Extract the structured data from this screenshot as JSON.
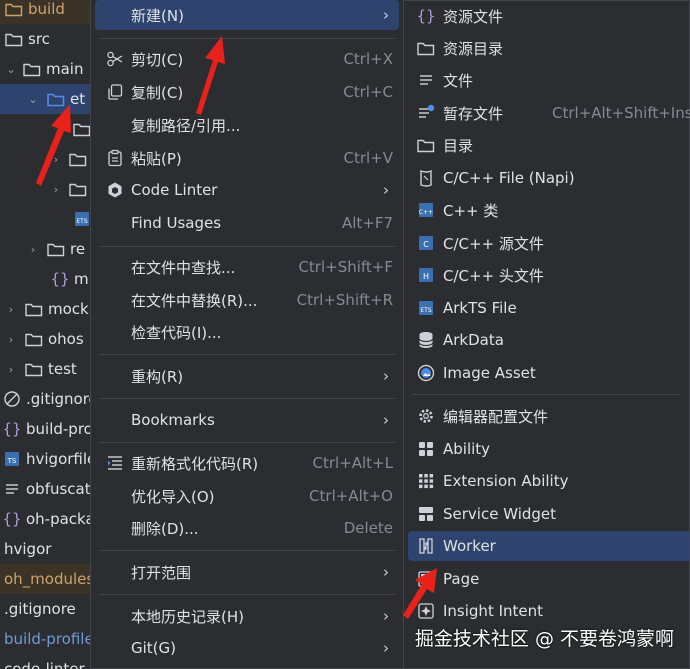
{
  "tree": {
    "items": [
      {
        "label": "build"
      },
      {
        "label": "src"
      },
      {
        "label": "main"
      },
      {
        "label": "et"
      },
      {
        "label": ""
      },
      {
        "label": ""
      },
      {
        "label": ""
      },
      {
        "label": ""
      },
      {
        "label": "re"
      },
      {
        "label": "m"
      },
      {
        "label": "mock"
      },
      {
        "label": "ohos"
      },
      {
        "label": "test"
      },
      {
        "label": ".gitignore"
      },
      {
        "label": "build-pro"
      },
      {
        "label": "hvigorfile"
      },
      {
        "label": "obfuscat"
      },
      {
        "label": "oh-packa"
      },
      {
        "label": "hvigor"
      },
      {
        "label": "oh_modules"
      },
      {
        "label": ".gitignore"
      },
      {
        "label": "build-profile"
      },
      {
        "label": "code-linter"
      }
    ]
  },
  "context_menu": {
    "new": {
      "label": "新建(N)"
    },
    "cut": {
      "label": "剪切(C)",
      "shortcut": "Ctrl+X"
    },
    "copy": {
      "label": "复制(C)",
      "shortcut": "Ctrl+C"
    },
    "copy_path": {
      "label": "复制路径/引用..."
    },
    "paste": {
      "label": "粘贴(P)",
      "shortcut": "Ctrl+V"
    },
    "code_linter": {
      "label": "Code Linter"
    },
    "find_usages": {
      "label": "Find Usages",
      "shortcut": "Alt+F7"
    },
    "find_in_files": {
      "label": "在文件中查找...",
      "shortcut": "Ctrl+Shift+F"
    },
    "replace_in_files": {
      "label": "在文件中替换(R)...",
      "shortcut": "Ctrl+Shift+R"
    },
    "inspect_code": {
      "label": "检查代码(I)..."
    },
    "refactor": {
      "label": "重构(R)"
    },
    "bookmarks": {
      "label": "Bookmarks"
    },
    "reformat": {
      "label": "重新格式化代码(R)",
      "shortcut": "Ctrl+Alt+L"
    },
    "optimize_imports": {
      "label": "优化导入(O)",
      "shortcut": "Ctrl+Alt+O"
    },
    "delete": {
      "label": "删除(D)...",
      "shortcut": "Delete"
    },
    "open_in": {
      "label": "打开范围"
    },
    "local_history": {
      "label": "本地历史记录(H)"
    },
    "git": {
      "label": "Git(G)"
    }
  },
  "submenu": {
    "resource_file": {
      "label": "资源文件"
    },
    "resource_dir": {
      "label": "资源目录"
    },
    "file": {
      "label": "文件"
    },
    "scratch_file": {
      "label": "暂存文件",
      "shortcut": "Ctrl+Alt+Shift+Insert"
    },
    "directory": {
      "label": "目录"
    },
    "cpp_napi": {
      "label": "C/C++ File (Napi)"
    },
    "cpp_class": {
      "label": "C++ 类"
    },
    "cpp_source": {
      "label": "C/C++ 源文件"
    },
    "cpp_header": {
      "label": "C/C++ 头文件"
    },
    "arkts_file": {
      "label": "ArkTS File"
    },
    "arkdata": {
      "label": "ArkData"
    },
    "image_asset": {
      "label": "Image Asset"
    },
    "editor_config": {
      "label": "编辑器配置文件"
    },
    "ability": {
      "label": "Ability"
    },
    "extension_ability": {
      "label": "Extension Ability"
    },
    "service_widget": {
      "label": "Service Widget"
    },
    "worker": {
      "label": "Worker"
    },
    "page": {
      "label": "Page"
    },
    "insight_intent": {
      "label": "Insight Intent"
    }
  },
  "watermark": "掘金技术社区 @ 不要卷鸿蒙啊",
  "colors": {
    "background": "#2b2d30",
    "selection": "#2e436e",
    "arrow": "#e8221b",
    "shortcut_text": "#868a91"
  }
}
